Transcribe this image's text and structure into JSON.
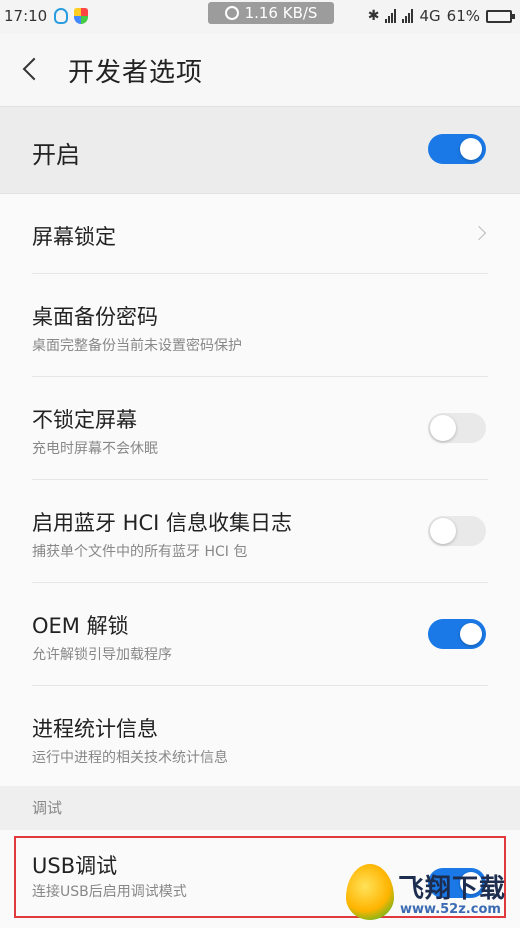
{
  "statusbar": {
    "time": "17:10",
    "net_speed": "1.16 KB/S",
    "network": "4G",
    "battery": "61%",
    "battery_level": 0.61
  },
  "header": {
    "title": "开发者选项"
  },
  "master": {
    "label": "开启",
    "on": true
  },
  "items": [
    {
      "title": "屏幕锁定",
      "subtitle": "",
      "control": "chevron"
    },
    {
      "title": "桌面备份密码",
      "subtitle": "桌面完整备份当前未设置密码保护",
      "control": "none"
    },
    {
      "title": "不锁定屏幕",
      "subtitle": "充电时屏幕不会休眠",
      "control": "switch",
      "on": false
    },
    {
      "title": "启用蓝牙 HCI 信息收集日志",
      "subtitle": "捕获单个文件中的所有蓝牙 HCI 包",
      "control": "switch",
      "on": false
    },
    {
      "title": "OEM 解锁",
      "subtitle": "允许解锁引导加载程序",
      "control": "switch",
      "on": true
    },
    {
      "title": "进程统计信息",
      "subtitle": "运行中进程的相关技术统计信息",
      "control": "none"
    }
  ],
  "section": {
    "label": "调试"
  },
  "usb": {
    "title": "USB调试",
    "subtitle": "连接USB后启用调试模式",
    "on": true
  },
  "watermark": {
    "name": "飞翔下载",
    "url": "www.52z.com"
  },
  "colors": {
    "accent": "#1a79e6",
    "highlight": "#e0393e"
  }
}
